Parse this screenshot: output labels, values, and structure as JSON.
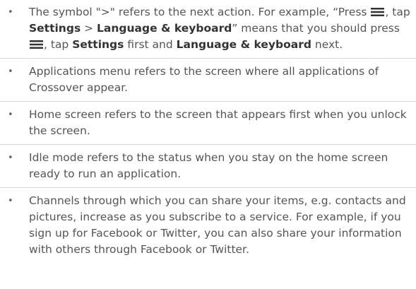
{
  "bullet_symbol": "•",
  "icon": {
    "name": "menu-icon"
  },
  "items": [
    {
      "t1": "The symbol \">\" refers to the next action. For example, “Press ",
      "t2": ", tap ",
      "settings": "Settings",
      "sep": " > ",
      "language": "Language & keyboard",
      "t3": "” means that you should press ",
      "t4": ", tap ",
      "settings2": "Settings",
      "t5": " first and ",
      "language2": "Language & keyboard",
      "t6": " next."
    },
    {
      "text": "Applications menu refers to the screen where all applications of Crossover appear."
    },
    {
      "text": "Home screen refers to the screen that appears first when you unlock the screen."
    },
    {
      "text": "Idle mode refers to the status when you stay on the home screen ready to run an application."
    },
    {
      "text": "Channels through which you can share your items, e.g. contacts and pictures, increase as you subscribe to a service. For example, if you sign up for Facebook or Twitter, you can also share your information with others through Facebook or Twitter."
    }
  ]
}
